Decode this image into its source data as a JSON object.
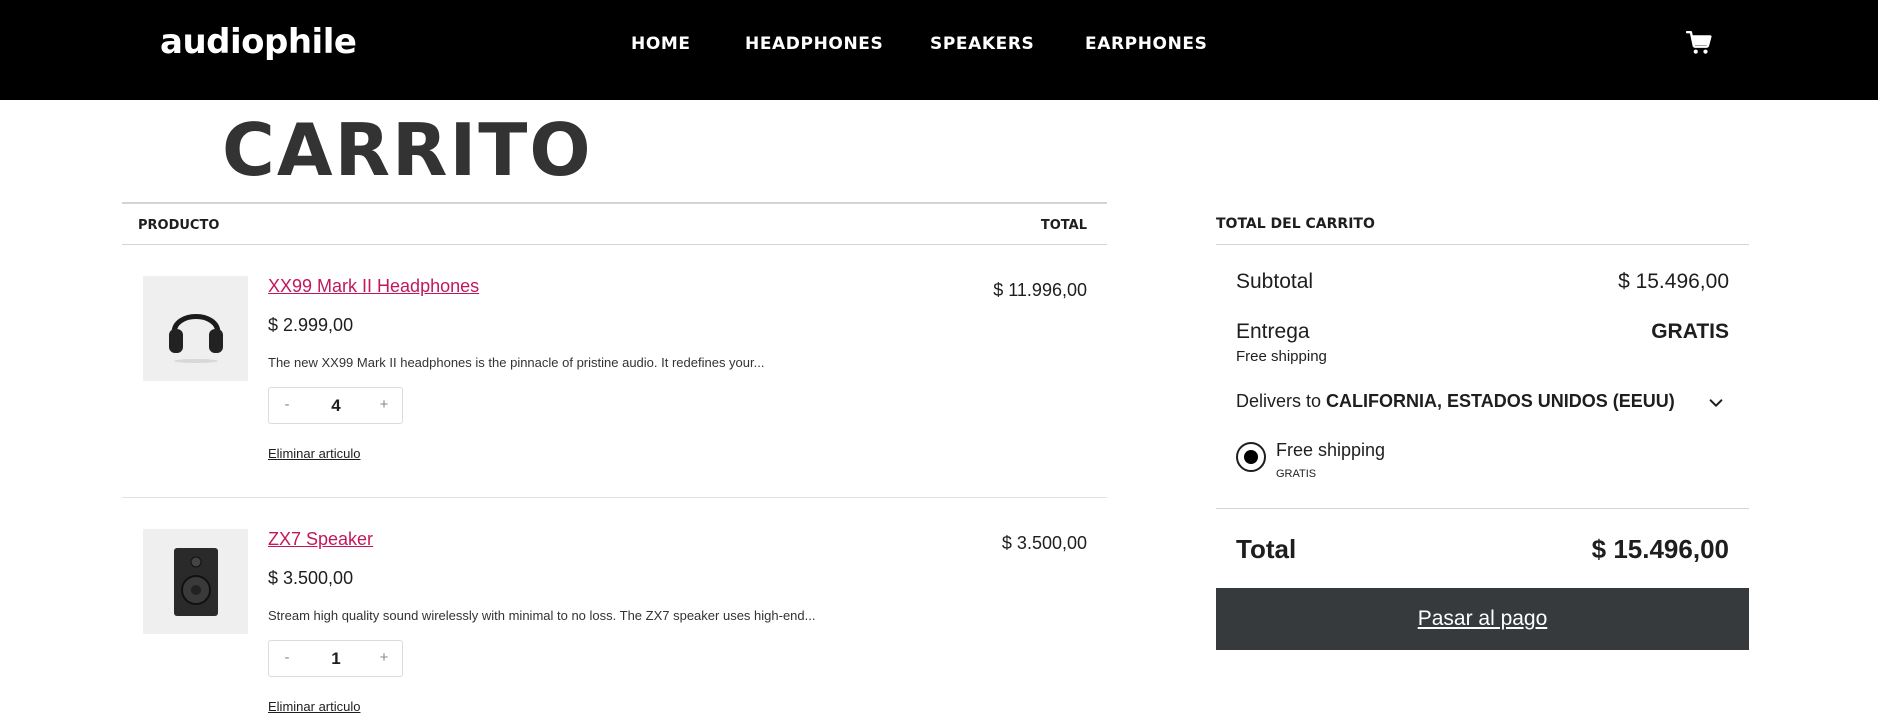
{
  "header": {
    "logo": "audiophile",
    "nav": [
      "HOME",
      "HEADPHONES",
      "SPEAKERS",
      "EARPHONES"
    ]
  },
  "page": {
    "title": "CARRITO"
  },
  "cart": {
    "col_product": "PRODUCTO",
    "col_total": "TOTAL",
    "items": [
      {
        "name": "XX99 Mark II Headphones",
        "price": "$ 2.999,00",
        "description": "The new XX99 Mark II headphones is the pinnacle of pristine audio. It redefines your...",
        "quantity": "4",
        "minus": "-",
        "plus": "+",
        "remove": "Eliminar articulo",
        "line_total": "$ 11.996,00",
        "image": "headphones-image"
      },
      {
        "name": "ZX7 Speaker",
        "price": "$ 3.500,00",
        "description": "Stream high quality sound wirelessly with minimal to no loss. The ZX7 speaker uses high-end...",
        "quantity": "1",
        "minus": "-",
        "plus": "+",
        "remove": "Eliminar articulo",
        "line_total": "$ 3.500,00",
        "image": "speaker-image"
      }
    ]
  },
  "summary": {
    "heading": "TOTAL DEL CARRITO",
    "subtotal_label": "Subtotal",
    "subtotal_value": "$ 15.496,00",
    "delivery_label": "Entrega",
    "delivery_value": "GRATIS",
    "delivery_note": "Free shipping",
    "delivers_to_prefix": "Delivers to",
    "delivers_to_location": "CALIFORNIA, ESTADOS UNIDOS (EEUU)",
    "option_label": "Free shipping",
    "option_sub": "GRATIS",
    "total_label": "Total",
    "total_value": "$ 15.496,00",
    "checkout_label": "Pasar al pago"
  },
  "colors": {
    "header_bg": "#000000",
    "link": "#c2185b",
    "checkout_bg": "#373a3c"
  }
}
